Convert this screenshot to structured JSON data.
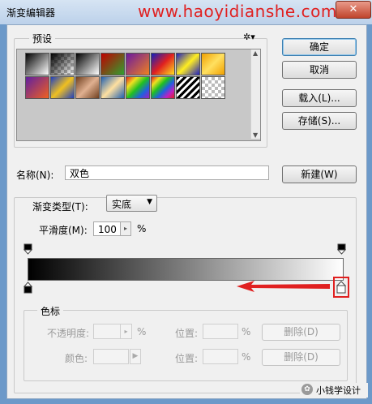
{
  "window": {
    "title": "渐变编辑器",
    "watermark": "www.haoyidianshe.com",
    "close_glyph": "✕"
  },
  "buttons": {
    "ok": "确定",
    "cancel": "取消",
    "load": "载入(L)...",
    "save": "存储(S)...",
    "new": "新建(W)"
  },
  "presets": {
    "label": "预设",
    "gear_glyph": "✲▾"
  },
  "name": {
    "label": "名称(N):",
    "value": "双色"
  },
  "gradient_type": {
    "label": "渐变类型(T):",
    "value": "实底",
    "arrow": "▼"
  },
  "smoothness": {
    "label": "平滑度(M):",
    "value": "100",
    "unit": "%"
  },
  "color_stops": {
    "label": "色标",
    "opacity_label": "不透明度:",
    "opacity_unit": "%",
    "location_label": "位置:",
    "location_unit": "%",
    "delete_label": "删除(D)",
    "color_label": "颜色:",
    "location2_label": "位置:",
    "location2_unit": "%",
    "delete2_label": "删除(D)"
  },
  "gradient": {
    "start_color": "#000000",
    "end_color": "#ffffff"
  },
  "annotation": {
    "color": "#e02020"
  },
  "brand": {
    "text": "小钱学设计"
  }
}
